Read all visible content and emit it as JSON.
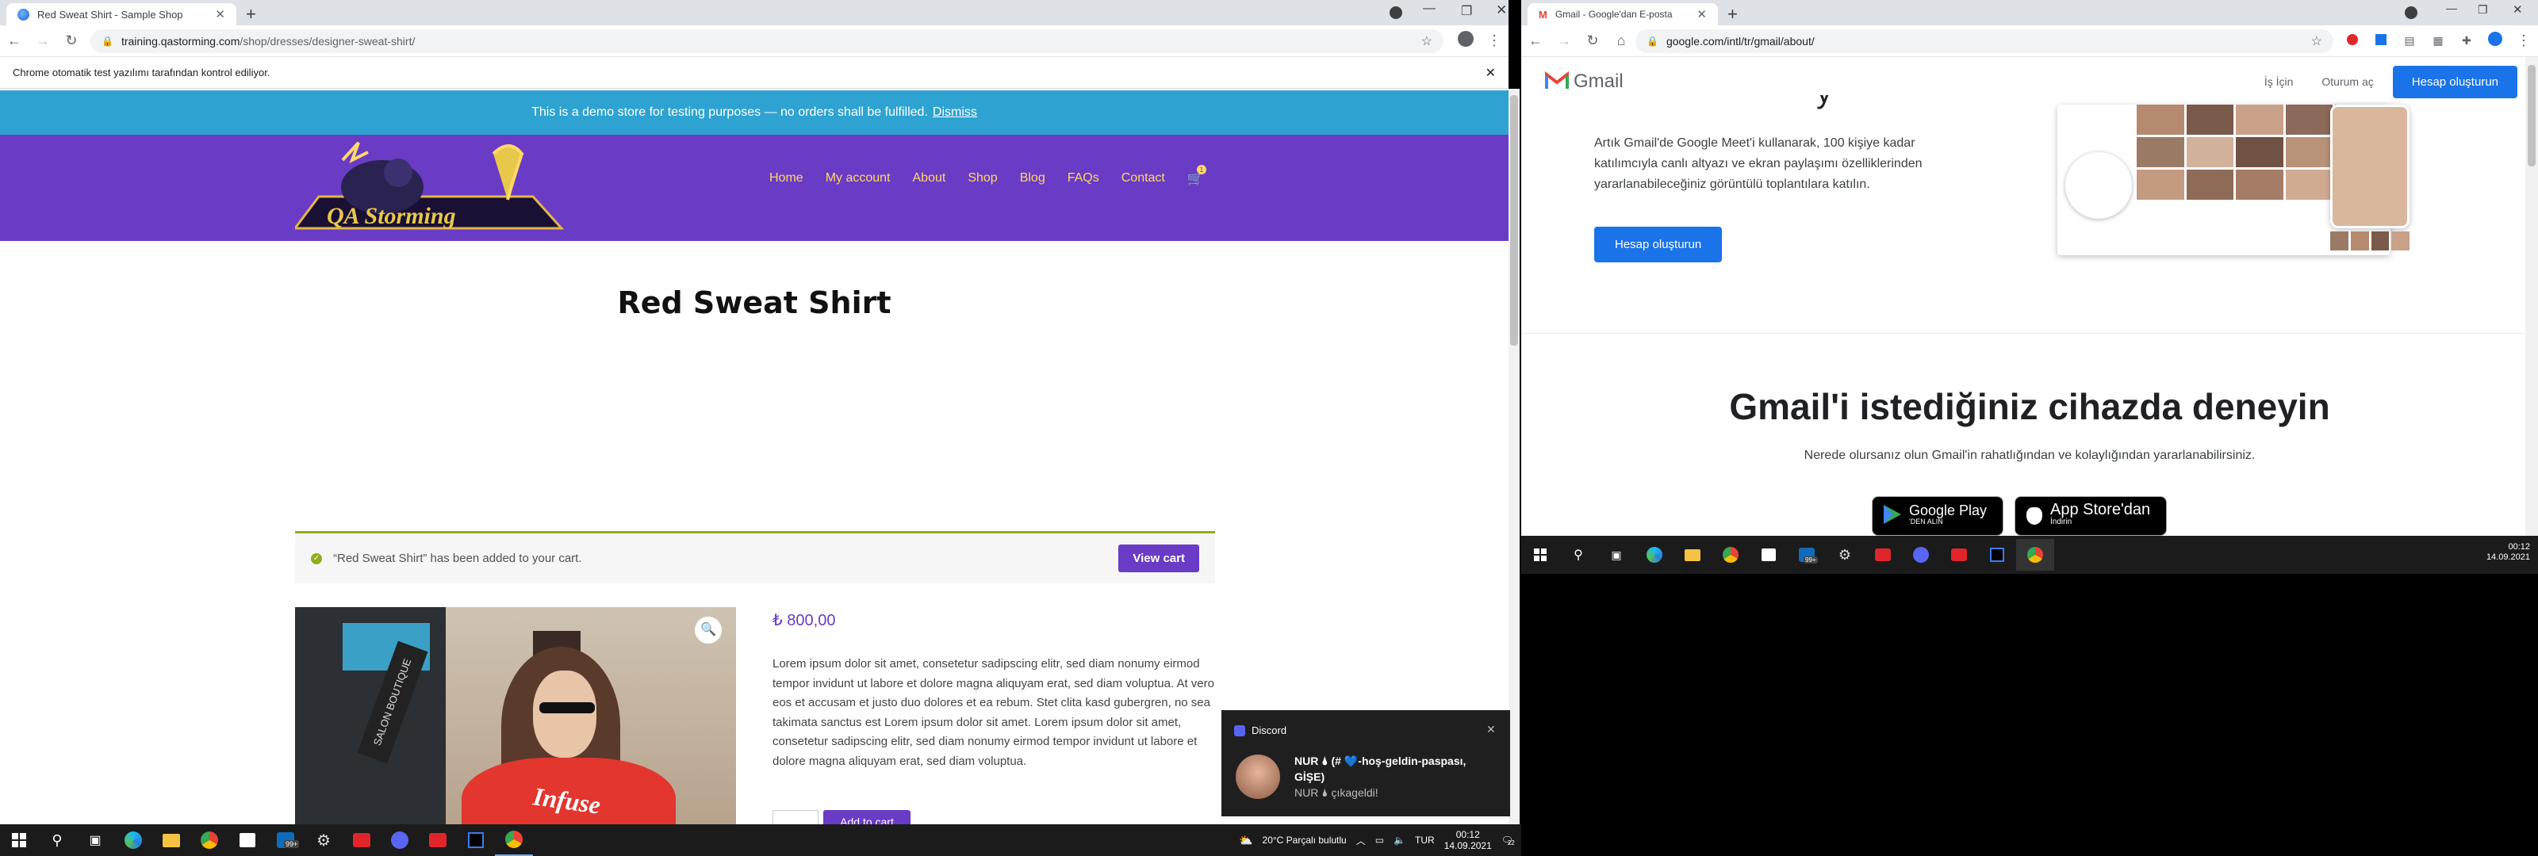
{
  "left_browser": {
    "tab_title": "Red Sweat Shirt - Sample Shop",
    "new_tab": "+",
    "url_domain": "training.qastorming.com",
    "url_path": "/shop/dresses/designer-sweat-shirt/",
    "automation_notice": "Chrome otomatik test yazılımı tarafından kontrol ediliyor.",
    "demo_notice": "This is a demo store for testing purposes — no orders shall be fulfilled.",
    "dismiss": "Dismiss",
    "logo_text": "QA Storming",
    "nav": [
      "Home",
      "My account",
      "About",
      "Shop",
      "Blog",
      "FAQs",
      "Contact"
    ],
    "cart_count": "1",
    "page_title": "Red Sweat Shirt",
    "cart_message": "“Red Sweat Shirt” has been added to your cart.",
    "view_cart": "View cart",
    "price": "₺ 800,00",
    "description": "Lorem ipsum dolor sit amet, consetetur sadipscing elitr, sed diam nonumy eirmod tempor invidunt ut labore et dolore magna aliquyam erat, sed diam voluptua. At vero eos et accusam et justo duo dolores et ea rebum. Stet clita kasd gubergren, no sea takimata sanctus est Lorem ipsum dolor sit amet. Lorem ipsum dolor sit amet, consetetur sadipscing elitr, sed diam nonumy eirmod tempor invidunt ut labore et dolore magna aliquyam erat, sed diam voluptua.",
    "add_to_cart": "Add to cart",
    "shirt_text": "Infuse",
    "shop_sign": "SALON BOUTIQUE"
  },
  "discord_toast": {
    "app": "Discord",
    "line1": "NUR 🌢 (# 💙-hoş-geldin-paspası,",
    "line2": "GİŞE)",
    "line3": "NUR 🌢 çıkageldi!"
  },
  "left_taskbar": {
    "weather": "20°C  Parçalı bulutlu",
    "lang": "TUR",
    "time": "00:12",
    "date": "14.09.2021",
    "notif_count": "22",
    "badge": "99+"
  },
  "right_browser": {
    "tab_title": "Gmail - Google'dan E-posta",
    "new_tab": "+",
    "url": "google.com/intl/tr/gmail/about/",
    "logo": "Gmail",
    "business": "İş İçin",
    "signin": "Oturum aç",
    "create": "Hesap oluşturun",
    "hero_text": "Artık Gmail'de Google Meet'i kullanarak, 100 kişiye kadar katılımcıyla canlı altyazı ve ekran paylaşımı özelliklerinden yararlanabileceğiniz görüntülü toplantılara katılın.",
    "hero_button": "Hesap oluşturun",
    "try_title": "Gmail'i istediğiniz cihazda deneyin",
    "try_sub": "Nerede olursanız olun Gmail'in rahatlığından ve kolaylığından yararlanabilirsiniz.",
    "google_play": "Google Play",
    "google_play_top": "'DEN ALIN",
    "app_store": "App Store'dan",
    "app_store_top": "İndirin"
  },
  "right_taskbar": {
    "time": "00:12",
    "date": "14.09.2021",
    "badge": "99+"
  },
  "colors": {
    "purple": "#6a3bc4",
    "blue_bar": "#2ea3d1",
    "gold": "#ffd86b",
    "google_blue": "#1a73e8"
  }
}
